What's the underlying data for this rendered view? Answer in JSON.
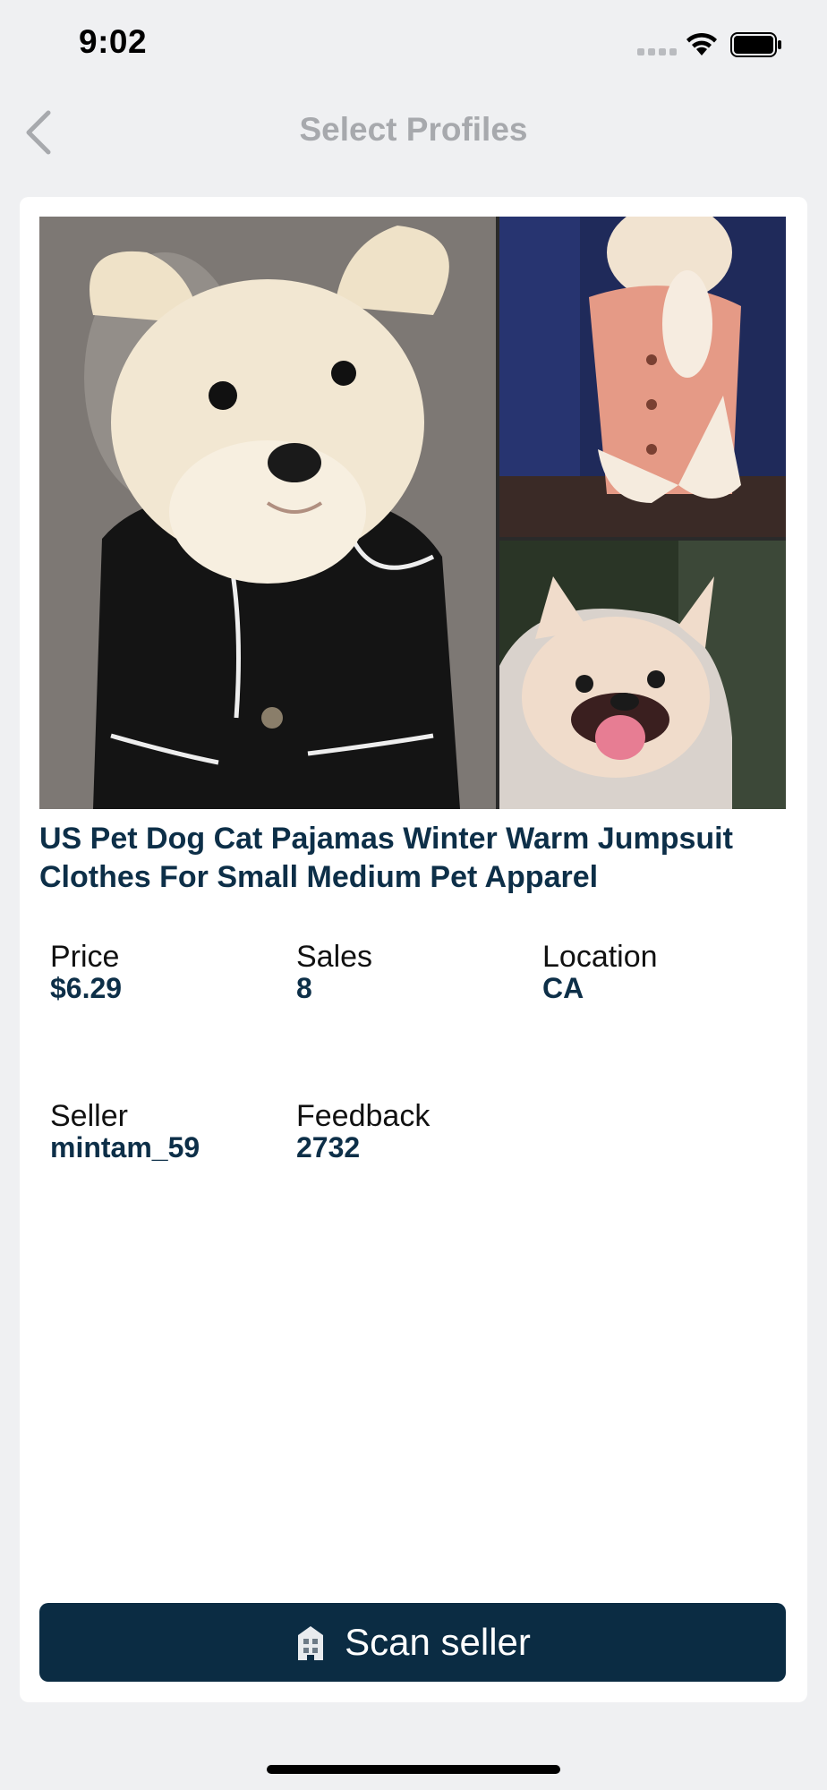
{
  "status_bar": {
    "time": "9:02"
  },
  "nav": {
    "title": "Select Profiles"
  },
  "product": {
    "title": "US Pet Dog Cat Pajamas Winter Warm Jumpsuit Clothes For Small Medium Pet Apparel",
    "images": [
      "product-photo-main",
      "product-photo-top",
      "product-photo-bottom"
    ]
  },
  "stats": [
    {
      "label": "Price",
      "value": "$6.29"
    },
    {
      "label": "Sales",
      "value": "8"
    },
    {
      "label": "Location",
      "value": "CA"
    },
    {
      "label": "Seller",
      "value": "mintam_59"
    },
    {
      "label": "Feedback",
      "value": "2732"
    }
  ],
  "actions": {
    "scan_seller": "Scan seller"
  },
  "colors": {
    "accent": "#0b2c43",
    "title_text": "#0d2f48",
    "background": "#eff0f2",
    "nav_title": "#a7a9ad"
  }
}
